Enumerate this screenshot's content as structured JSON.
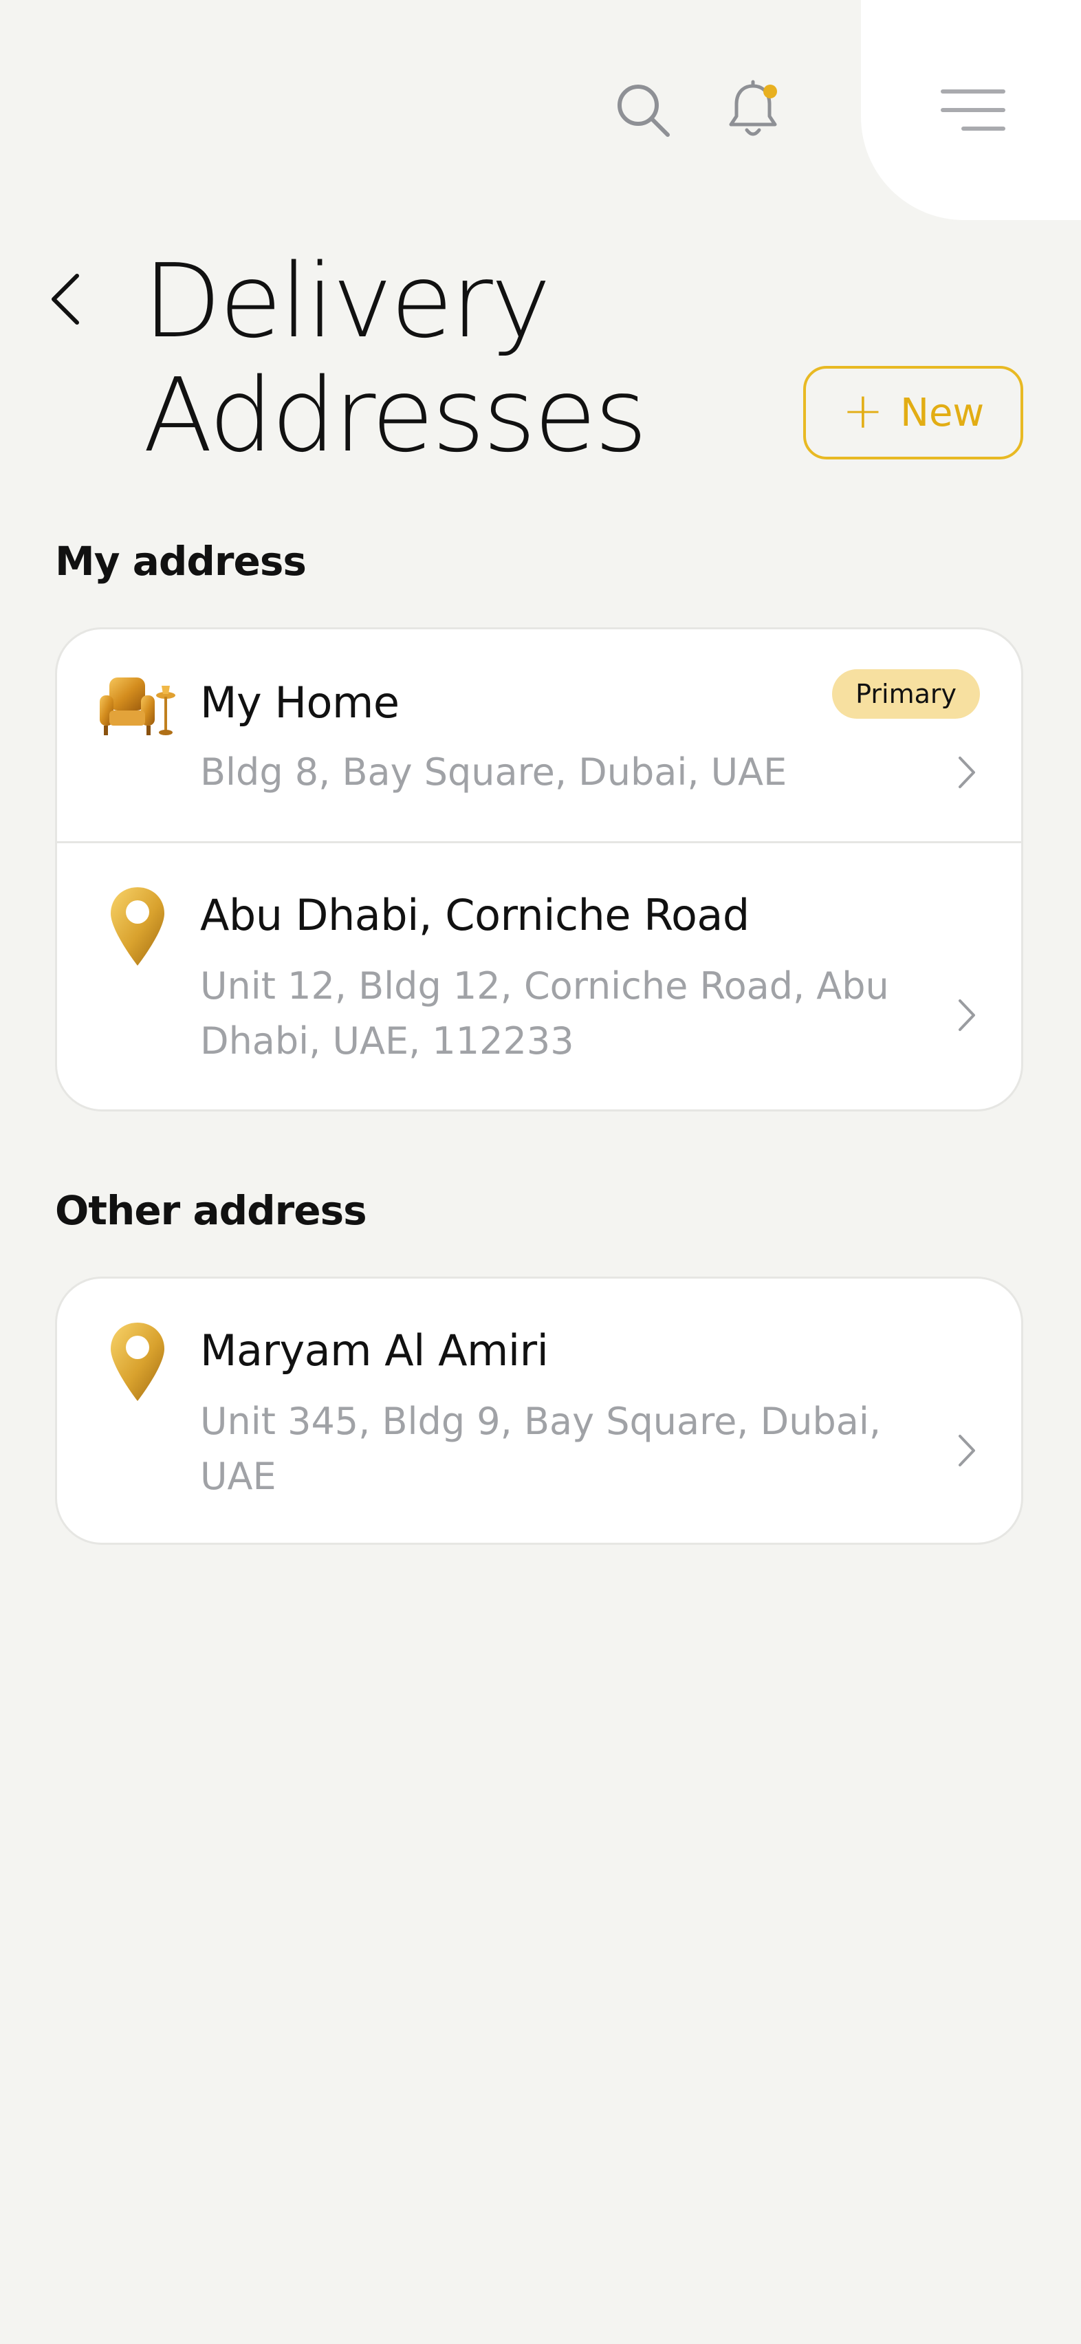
{
  "header": {
    "title_line1": "Delivery",
    "title_line2": "Addresses",
    "new_button_label": "New"
  },
  "colors": {
    "accent": "#e2ad14",
    "badge_bg": "#f7e0a0",
    "background": "#f4f4f1",
    "muted_text": "#a0a2a6"
  },
  "icons": {
    "search": "search-icon",
    "notifications": "bell-icon",
    "menu": "menu-icon",
    "back": "chevron-left-icon",
    "home": "armchair-icon",
    "location": "location-pin-icon",
    "row_arrow": "chevron-right-icon"
  },
  "sections": {
    "my_address": {
      "title": "My address",
      "items": [
        {
          "name": "My Home",
          "address": "Bldg 8, Bay Square, Dubai, UAE",
          "badge": "Primary"
        },
        {
          "name": "Abu Dhabi, Corniche Road",
          "address": "Unit 12, Bldg 12, Corniche Road, Abu Dhabi, UAE, 112233"
        }
      ]
    },
    "other_address": {
      "title": "Other address",
      "items": [
        {
          "name": "Maryam Al Amiri",
          "address": "Unit 345, Bldg 9, Bay Square, Dubai, UAE"
        }
      ]
    }
  }
}
